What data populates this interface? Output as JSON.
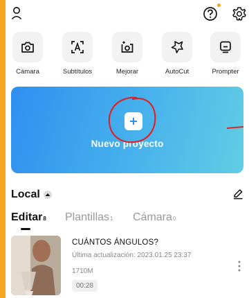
{
  "theme": {
    "accent": "#2f8ff0",
    "banner_end": "#62cde3",
    "annotation_circle": "#d8262b",
    "notification_dot": "#f5a623"
  },
  "topbar": {
    "profile_icon": "person-icon",
    "help_icon": "question-circle-icon",
    "settings_icon": "gear-icon"
  },
  "tools": [
    {
      "label": "Cámara",
      "icon": "camera-icon"
    },
    {
      "label": "Subtítulos",
      "icon": "text-scan-icon"
    },
    {
      "label": "Mejorar",
      "icon": "enhance-icon"
    },
    {
      "label": "AutoCut",
      "icon": "sparkle-star-icon"
    },
    {
      "label": "Prompter",
      "icon": "teleprompter-icon"
    }
  ],
  "new_project": {
    "label": "Nuevo proyecto",
    "icon": "plus-icon"
  },
  "local": {
    "title": "Local",
    "edit_icon": "pencil-icon"
  },
  "tabs": [
    {
      "label": "Editar",
      "count": "8",
      "active": true
    },
    {
      "label": "Plantillas",
      "count": "1",
      "active": false
    },
    {
      "label": "Cámara",
      "count": "0",
      "active": false
    }
  ],
  "project": {
    "title": "CUÁNTOS ÁNGULOS?",
    "updated": "Última actualización: 2023.01.25 23:37",
    "size": "1710M",
    "duration": "00:28"
  }
}
